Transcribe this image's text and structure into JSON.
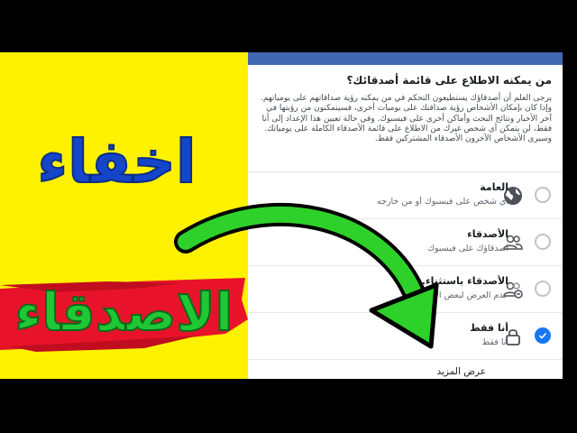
{
  "thumbnail": {
    "title_line1": "اخفاء",
    "title_line2": "الاصدقاء"
  },
  "privacy_dialog": {
    "question": "من يمكنه الاطلاع على قائمة أصدقائك؟",
    "description": "يرجى العلم أن أصدقاؤك يستطيعون التحكم في من يمكنه رؤية صداقاتهم على يومياتهم. وإذا كان بإمكان الأشخاص رؤية صداقتك على يوميات أخرى، فسيتمكنون من رؤيتها في آخر الأخبار ونتائج البحث وأماكن أخرى على فيسبوك. وفي حالة تعيين هذا الإعداد إلى أنا فقط، لن يتمكن أي شخص غيرك من الاطلاع على قائمة الأصدقاء الكاملة على يومياتك. وسيرى الأشخاص الآخرون الأصدقاء المشتركين فقط.",
    "options": [
      {
        "title": "العامة",
        "subtitle": "أي شخص على فيسبوك أو من خارجه",
        "icon": "globe-icon",
        "selected": false
      },
      {
        "title": "الأصدقاء",
        "subtitle": "أصدقاؤك على فيسبوك",
        "icon": "friends-icon",
        "selected": false
      },
      {
        "title": "الأصدقاء باستثناء...",
        "subtitle": "عدم العرض لبعض الأصدقاء",
        "icon": "friends-except-icon",
        "selected": false
      },
      {
        "title": "أنا فقط",
        "subtitle": "أنا فقط",
        "icon": "lock-icon",
        "selected": true
      }
    ],
    "see_more": "عرض المزيد"
  },
  "colors": {
    "thumbnail_bg": "#fff200",
    "title_blue": "#1546c9",
    "title_green": "#1fc735",
    "brush_red": "#e8132a",
    "arrow_green": "#2ed12a",
    "facebook_blue": "#1877f2",
    "header_blue": "#4267b2"
  }
}
